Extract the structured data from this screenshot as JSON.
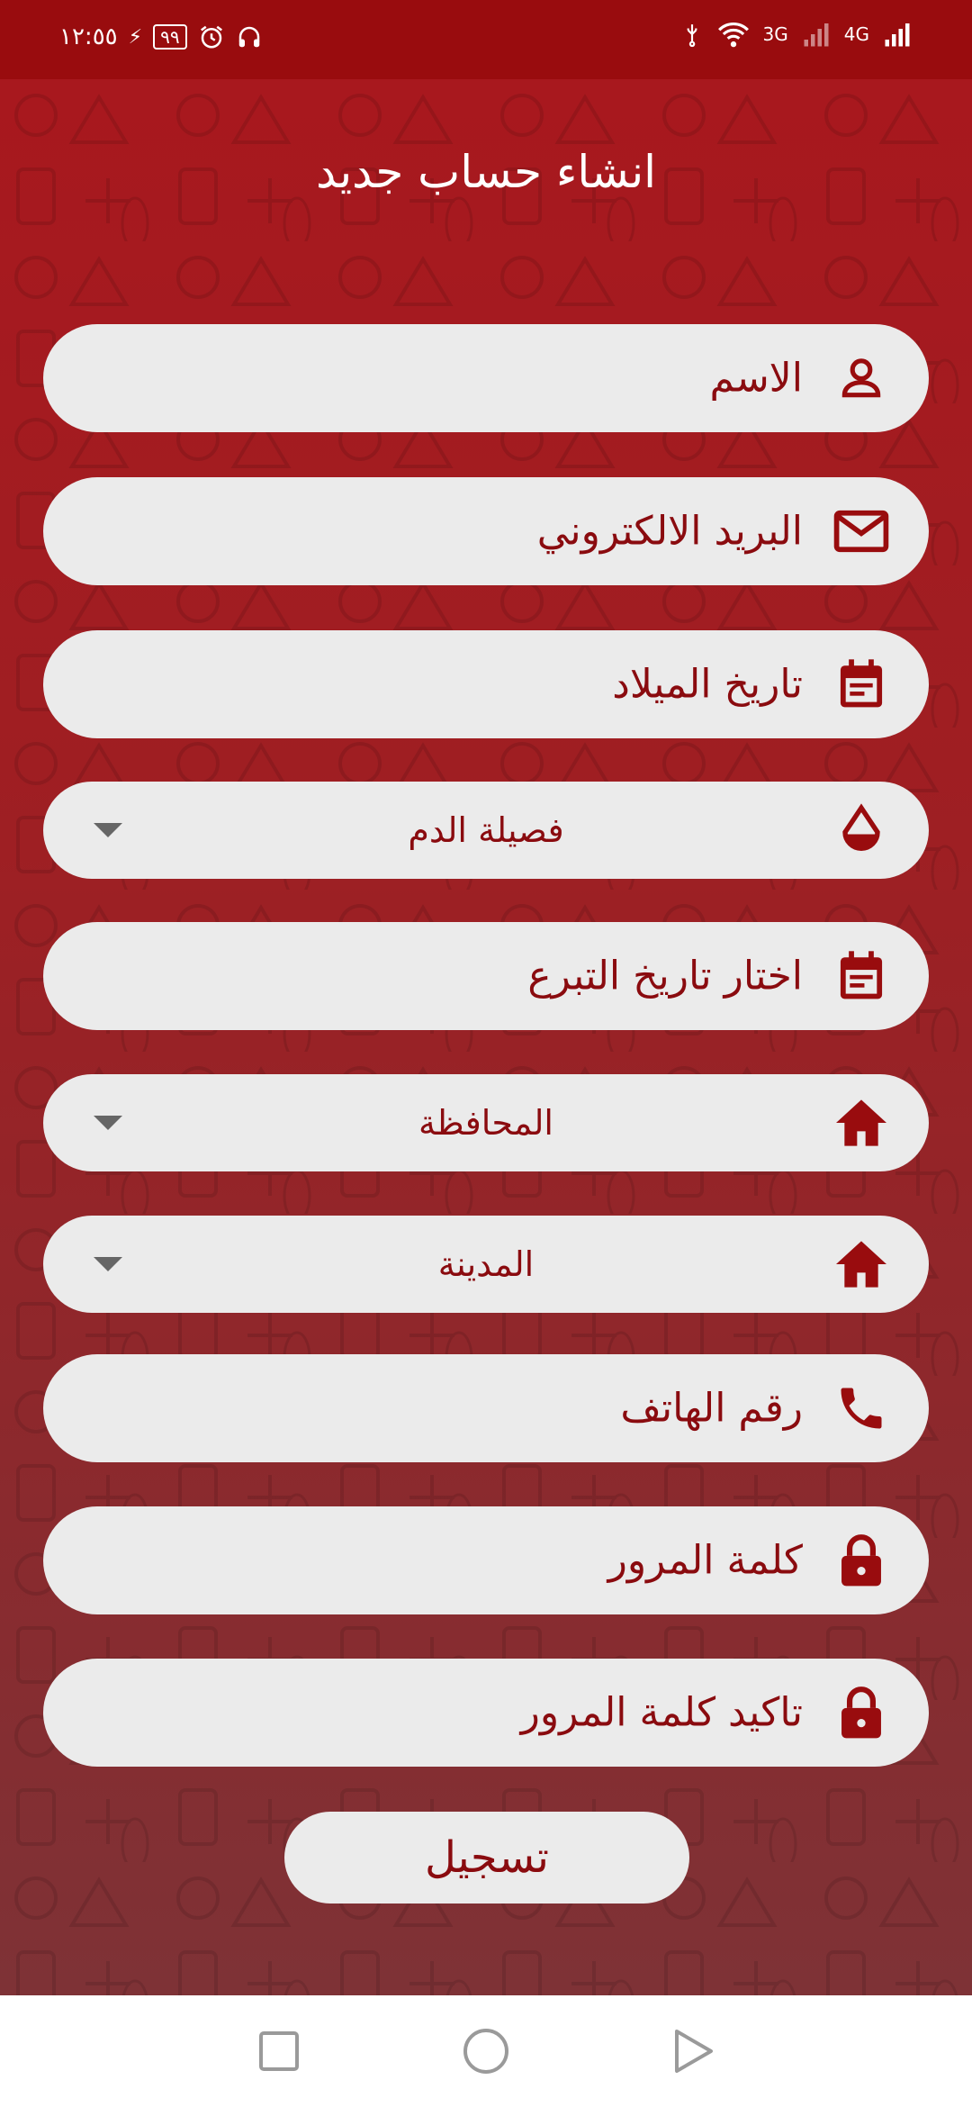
{
  "status_bar": {
    "time": "١٢:٥٥",
    "battery": "٩٩",
    "network_1": "3G",
    "network_2": "4G"
  },
  "page": {
    "title": "انشاء حساب جديد"
  },
  "form": {
    "name": {
      "label": "الاسم",
      "icon": "person-icon"
    },
    "email": {
      "label": "البريد الالكتروني",
      "icon": "envelope-icon"
    },
    "birth_date": {
      "label": "تاريخ الميلاد",
      "icon": "calendar-icon"
    },
    "blood_type": {
      "label": "فصيلة الدم",
      "icon": "drop-icon"
    },
    "donation_date": {
      "label": "اختار تاريخ التبرع",
      "icon": "calendar-icon"
    },
    "governorate": {
      "label": "المحافظة",
      "icon": "home-icon"
    },
    "city": {
      "label": "المدينة",
      "icon": "home-icon"
    },
    "phone": {
      "label": "رقم الهاتف",
      "icon": "phone-icon"
    },
    "password": {
      "label": "كلمة المرور",
      "icon": "lock-icon"
    },
    "confirm_password": {
      "label": "تاكيد كلمة المرور",
      "icon": "lock-icon"
    },
    "submit_label": "تسجيل"
  },
  "colors": {
    "accent": "#990c0e",
    "field_bg": "#ebebeb",
    "field_text": "#8a0b0f"
  }
}
